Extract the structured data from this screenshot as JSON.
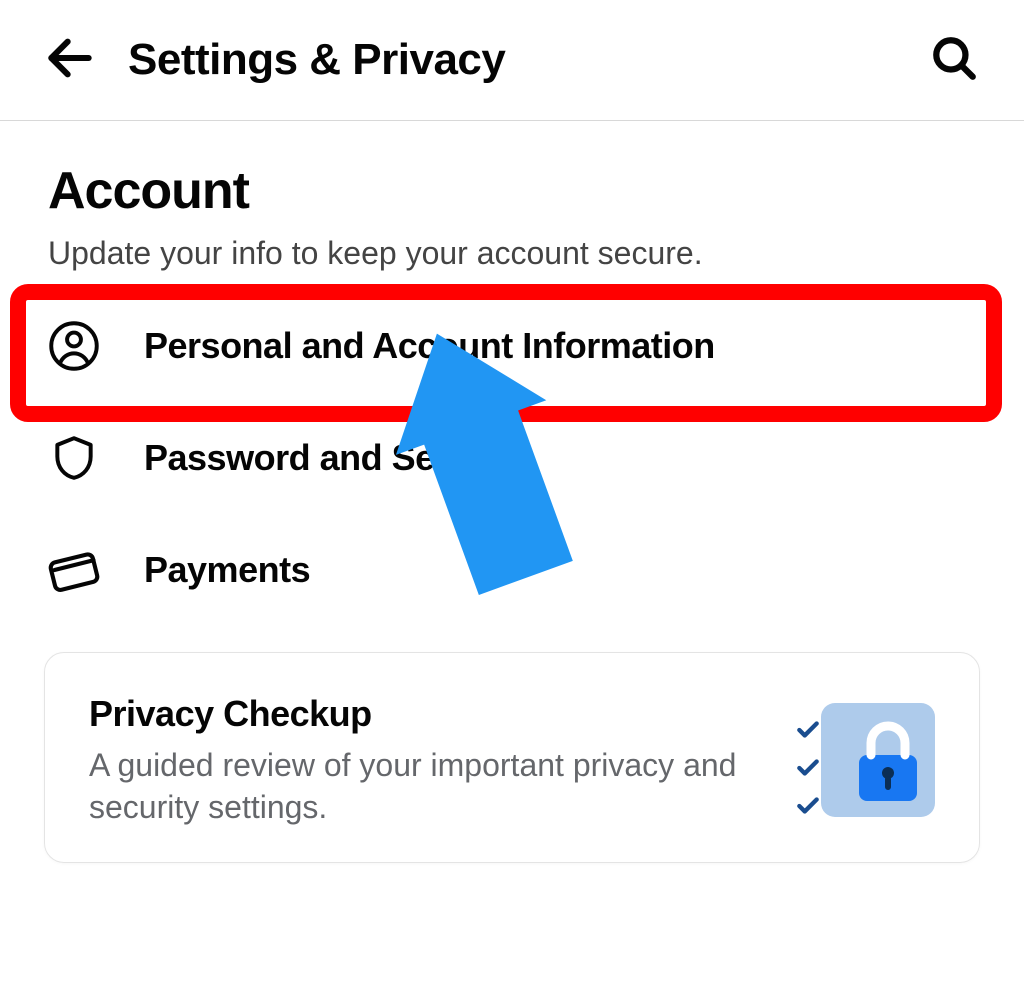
{
  "header": {
    "title": "Settings & Privacy"
  },
  "section": {
    "title": "Account",
    "subtitle": "Update your info to keep your account secure."
  },
  "menu": {
    "items": [
      {
        "icon": "person-icon",
        "label": "Personal and Account Information"
      },
      {
        "icon": "shield-icon",
        "label": "Password and Security"
      },
      {
        "icon": "card-icon",
        "label": "Payments"
      }
    ]
  },
  "annotation": {
    "highlight_index": 0,
    "arrow_color": "#2196f3",
    "highlight_color": "#ff0000"
  },
  "card": {
    "title": "Privacy Checkup",
    "desc": "A guided review of your important privacy and security settings."
  }
}
